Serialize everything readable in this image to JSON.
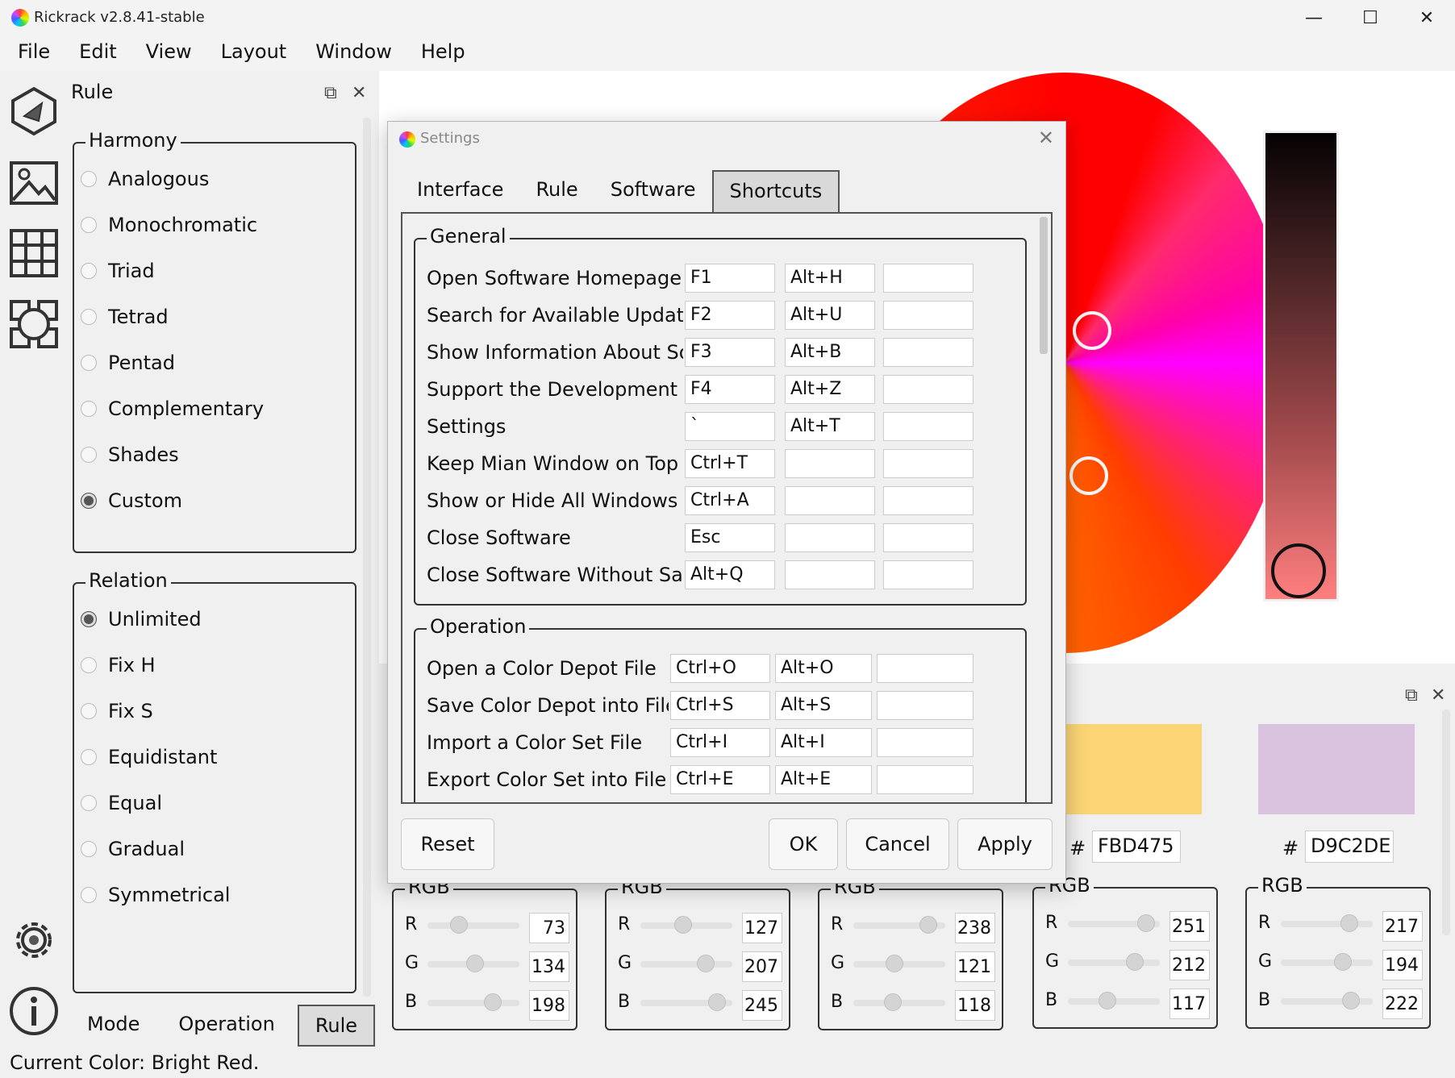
{
  "window": {
    "title": "Rickrack v2.8.41-stable",
    "controls": {
      "minimize": "—",
      "maximize": "☐",
      "close": "✕"
    }
  },
  "menu": [
    "File",
    "Edit",
    "View",
    "Layout",
    "Window",
    "Help"
  ],
  "rule_panel": {
    "title": "Rule",
    "harmony": {
      "legend": "Harmony",
      "options": [
        "Analogous",
        "Monochromatic",
        "Triad",
        "Tetrad",
        "Pentad",
        "Complementary",
        "Shades",
        "Custom"
      ],
      "selected": "Custom"
    },
    "relation": {
      "legend": "Relation",
      "options": [
        "Unlimited",
        "Fix H",
        "Fix S",
        "Equidistant",
        "Equal",
        "Gradual",
        "Symmetrical"
      ],
      "selected": "Unlimited"
    },
    "bottom_tabs": [
      "Mode",
      "Operation",
      "Rule"
    ],
    "active_tab": "Rule"
  },
  "status": "Current Color: Bright Red.",
  "color_sets": [
    {
      "hex": "",
      "rgb": {
        "legend": "RGB",
        "r": "73",
        "g": "134",
        "b": "198"
      }
    },
    {
      "hex": "",
      "rgb": {
        "legend": "RGB",
        "r": "127",
        "g": "207",
        "b": "245"
      }
    },
    {
      "hex": "",
      "rgb": {
        "legend": "RGB",
        "r": "238",
        "g": "121",
        "b": "118"
      }
    },
    {
      "hash": "#",
      "hex": "FBD475",
      "swatch": "#FBD475",
      "rgb": {
        "legend": "RGB",
        "r": "251",
        "g": "212",
        "b": "117"
      }
    },
    {
      "hash": "#",
      "hex": "D9C2DE",
      "swatch": "#D9C2DE",
      "rgb": {
        "legend": "RGB",
        "r": "217",
        "g": "194",
        "b": "222"
      }
    }
  ],
  "settings_dialog": {
    "title": "Settings",
    "tabs": [
      "Interface",
      "Rule",
      "Software",
      "Shortcuts"
    ],
    "active_tab": "Shortcuts",
    "general": {
      "legend": "General",
      "rows": [
        {
          "label": "Open Software Homepage",
          "k1": "F1",
          "k2": "Alt+H",
          "k3": ""
        },
        {
          "label": "Search for Available Update",
          "k1": "F2",
          "k2": "Alt+U",
          "k3": ""
        },
        {
          "label": "Show Information About Softwa",
          "k1": "F3",
          "k2": "Alt+B",
          "k3": ""
        },
        {
          "label": "Support the Development of Ric",
          "k1": "F4",
          "k2": "Alt+Z",
          "k3": ""
        },
        {
          "label": "Settings",
          "k1": "`",
          "k2": "Alt+T",
          "k3": ""
        },
        {
          "label": "Keep Mian Window on Top",
          "k1": "Ctrl+T",
          "k2": "",
          "k3": ""
        },
        {
          "label": "Show or Hide All Windows",
          "k1": "Ctrl+A",
          "k2": "",
          "k3": ""
        },
        {
          "label": "Close Software",
          "k1": "Esc",
          "k2": "",
          "k3": ""
        },
        {
          "label": "Close Software Without Saving",
          "k1": "Alt+Q",
          "k2": "",
          "k3": ""
        }
      ]
    },
    "operation": {
      "legend": "Operation",
      "rows": [
        {
          "label": "Open a Color Depot File",
          "k1": "Ctrl+O",
          "k2": "Alt+O",
          "k3": ""
        },
        {
          "label": "Save Color Depot into File",
          "k1": "Ctrl+S",
          "k2": "Alt+S",
          "k3": ""
        },
        {
          "label": "Import a Color Set File",
          "k1": "Ctrl+I",
          "k2": "Alt+I",
          "k3": ""
        },
        {
          "label": "Export Color Set into File",
          "k1": "Ctrl+E",
          "k2": "Alt+E",
          "k3": ""
        }
      ]
    },
    "buttons": {
      "reset": "Reset",
      "ok": "OK",
      "cancel": "Cancel",
      "apply": "Apply"
    }
  },
  "icons": {
    "toolbar": [
      "wheel-icon",
      "image-icon",
      "grid-icon",
      "mix-icon",
      "settings-icon",
      "info-icon"
    ]
  }
}
